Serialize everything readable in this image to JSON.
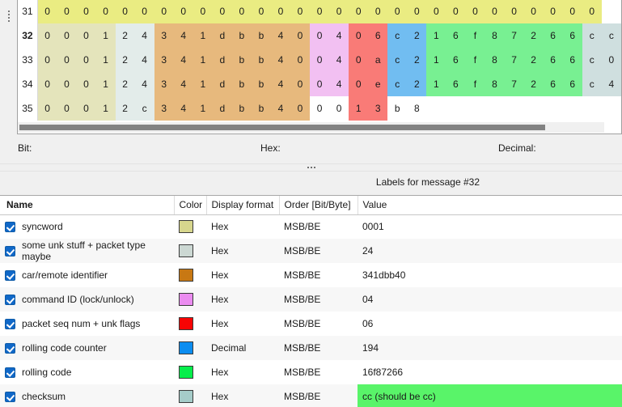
{
  "hex_view": {
    "row_header_label": "row-number",
    "selected_row": "32",
    "rows": [
      {
        "num": "31",
        "cells": [
          {
            "v": "0",
            "c": "#eaec82"
          },
          {
            "v": "0",
            "c": "#eaec82"
          },
          {
            "v": "0",
            "c": "#eaec82"
          },
          {
            "v": "0",
            "c": "#eaec82"
          },
          {
            "v": "0",
            "c": "#eaec82"
          },
          {
            "v": "0",
            "c": "#eaec82"
          },
          {
            "v": "0",
            "c": "#eaec82"
          },
          {
            "v": "0",
            "c": "#eaec82"
          },
          {
            "v": "0",
            "c": "#eaec82"
          },
          {
            "v": "0",
            "c": "#eaec82"
          },
          {
            "v": "0",
            "c": "#eaec82"
          },
          {
            "v": "0",
            "c": "#eaec82"
          },
          {
            "v": "0",
            "c": "#eaec82"
          },
          {
            "v": "0",
            "c": "#eaec82"
          },
          {
            "v": "0",
            "c": "#eaec82"
          },
          {
            "v": "0",
            "c": "#eaec82"
          },
          {
            "v": "0",
            "c": "#eaec82"
          },
          {
            "v": "0",
            "c": "#eaec82"
          },
          {
            "v": "0",
            "c": "#eaec82"
          },
          {
            "v": "0",
            "c": "#eaec82"
          },
          {
            "v": "0",
            "c": "#eaec82"
          },
          {
            "v": "0",
            "c": "#eaec82"
          },
          {
            "v": "0",
            "c": "#eaec82"
          },
          {
            "v": "0",
            "c": "#eaec82"
          },
          {
            "v": "0",
            "c": "#eaec82"
          },
          {
            "v": "0",
            "c": "#eaec82"
          },
          {
            "v": "0",
            "c": "#eaec82"
          },
          {
            "v": "0",
            "c": "#eaec82"
          },
          {
            "v": "0",
            "c": "#eaec82"
          }
        ]
      },
      {
        "num": "32",
        "selected": true,
        "cells": [
          {
            "v": "0",
            "c": "#e4e4bb"
          },
          {
            "v": "0",
            "c": "#e4e4bb"
          },
          {
            "v": "0",
            "c": "#e4e4bb"
          },
          {
            "v": "1",
            "c": "#e4e4bb"
          },
          {
            "v": "2",
            "c": "#e3ecea"
          },
          {
            "v": "4",
            "c": "#e3ecea"
          },
          {
            "v": "3",
            "c": "#e7b97d"
          },
          {
            "v": "4",
            "c": "#e7b97d"
          },
          {
            "v": "1",
            "c": "#e7b97d"
          },
          {
            "v": "d",
            "c": "#e7b97d"
          },
          {
            "v": "b",
            "c": "#e7b97d"
          },
          {
            "v": "b",
            "c": "#e7b97d"
          },
          {
            "v": "4",
            "c": "#e7b97d"
          },
          {
            "v": "0",
            "c": "#e7b97d"
          },
          {
            "v": "0",
            "c": "#f2c0f2"
          },
          {
            "v": "4",
            "c": "#f2c0f2"
          },
          {
            "v": "0",
            "c": "#f97b77"
          },
          {
            "v": "6",
            "c": "#f97b77"
          },
          {
            "v": "c",
            "c": "#71bdf1"
          },
          {
            "v": "2",
            "c": "#71bdf1"
          },
          {
            "v": "1",
            "c": "#78f092"
          },
          {
            "v": "6",
            "c": "#78f092"
          },
          {
            "v": "f",
            "c": "#78f092"
          },
          {
            "v": "8",
            "c": "#78f092"
          },
          {
            "v": "7",
            "c": "#78f092"
          },
          {
            "v": "2",
            "c": "#78f092"
          },
          {
            "v": "6",
            "c": "#78f092"
          },
          {
            "v": "6",
            "c": "#78f092"
          },
          {
            "v": "c",
            "c": "#cfdfdf"
          },
          {
            "v": "c",
            "c": "#cfdfdf"
          }
        ]
      },
      {
        "num": "33",
        "cells": [
          {
            "v": "0",
            "c": "#e4e4bb"
          },
          {
            "v": "0",
            "c": "#e4e4bb"
          },
          {
            "v": "0",
            "c": "#e4e4bb"
          },
          {
            "v": "1",
            "c": "#e4e4bb"
          },
          {
            "v": "2",
            "c": "#e3ecea"
          },
          {
            "v": "4",
            "c": "#e3ecea"
          },
          {
            "v": "3",
            "c": "#e7b97d"
          },
          {
            "v": "4",
            "c": "#e7b97d"
          },
          {
            "v": "1",
            "c": "#e7b97d"
          },
          {
            "v": "d",
            "c": "#e7b97d"
          },
          {
            "v": "b",
            "c": "#e7b97d"
          },
          {
            "v": "b",
            "c": "#e7b97d"
          },
          {
            "v": "4",
            "c": "#e7b97d"
          },
          {
            "v": "0",
            "c": "#e7b97d"
          },
          {
            "v": "0",
            "c": "#f2c0f2"
          },
          {
            "v": "4",
            "c": "#f2c0f2"
          },
          {
            "v": "0",
            "c": "#f97b77"
          },
          {
            "v": "a",
            "c": "#f97b77"
          },
          {
            "v": "c",
            "c": "#71bdf1"
          },
          {
            "v": "2",
            "c": "#71bdf1"
          },
          {
            "v": "1",
            "c": "#78f092"
          },
          {
            "v": "6",
            "c": "#78f092"
          },
          {
            "v": "f",
            "c": "#78f092"
          },
          {
            "v": "8",
            "c": "#78f092"
          },
          {
            "v": "7",
            "c": "#78f092"
          },
          {
            "v": "2",
            "c": "#78f092"
          },
          {
            "v": "6",
            "c": "#78f092"
          },
          {
            "v": "6",
            "c": "#78f092"
          },
          {
            "v": "c",
            "c": "#cfdfdf"
          },
          {
            "v": "0",
            "c": "#cfdfdf"
          }
        ]
      },
      {
        "num": "34",
        "cells": [
          {
            "v": "0",
            "c": "#e4e4bb"
          },
          {
            "v": "0",
            "c": "#e4e4bb"
          },
          {
            "v": "0",
            "c": "#e4e4bb"
          },
          {
            "v": "1",
            "c": "#e4e4bb"
          },
          {
            "v": "2",
            "c": "#e3ecea"
          },
          {
            "v": "4",
            "c": "#e3ecea"
          },
          {
            "v": "3",
            "c": "#e7b97d"
          },
          {
            "v": "4",
            "c": "#e7b97d"
          },
          {
            "v": "1",
            "c": "#e7b97d"
          },
          {
            "v": "d",
            "c": "#e7b97d"
          },
          {
            "v": "b",
            "c": "#e7b97d"
          },
          {
            "v": "b",
            "c": "#e7b97d"
          },
          {
            "v": "4",
            "c": "#e7b97d"
          },
          {
            "v": "0",
            "c": "#e7b97d"
          },
          {
            "v": "0",
            "c": "#f2c0f2"
          },
          {
            "v": "4",
            "c": "#f2c0f2"
          },
          {
            "v": "0",
            "c": "#f97b77"
          },
          {
            "v": "e",
            "c": "#f97b77"
          },
          {
            "v": "c",
            "c": "#71bdf1"
          },
          {
            "v": "2",
            "c": "#71bdf1"
          },
          {
            "v": "1",
            "c": "#78f092"
          },
          {
            "v": "6",
            "c": "#78f092"
          },
          {
            "v": "f",
            "c": "#78f092"
          },
          {
            "v": "8",
            "c": "#78f092"
          },
          {
            "v": "7",
            "c": "#78f092"
          },
          {
            "v": "2",
            "c": "#78f092"
          },
          {
            "v": "6",
            "c": "#78f092"
          },
          {
            "v": "6",
            "c": "#78f092"
          },
          {
            "v": "c",
            "c": "#cfdfdf"
          },
          {
            "v": "4",
            "c": "#cfdfdf"
          }
        ]
      },
      {
        "num": "35",
        "cells": [
          {
            "v": "0",
            "c": "#e4e4bb"
          },
          {
            "v": "0",
            "c": "#e4e4bb"
          },
          {
            "v": "0",
            "c": "#e4e4bb"
          },
          {
            "v": "1",
            "c": "#e4e4bb"
          },
          {
            "v": "2",
            "c": "#e3ecea"
          },
          {
            "v": "c",
            "c": "#e3ecea"
          },
          {
            "v": "3",
            "c": "#e7b97d"
          },
          {
            "v": "4",
            "c": "#e7b97d"
          },
          {
            "v": "1",
            "c": "#e7b97d"
          },
          {
            "v": "d",
            "c": "#e7b97d"
          },
          {
            "v": "b",
            "c": "#e7b97d"
          },
          {
            "v": "b",
            "c": "#e7b97d"
          },
          {
            "v": "4",
            "c": "#e7b97d"
          },
          {
            "v": "0",
            "c": "#e7b97d"
          },
          {
            "v": "0",
            "c": "#ffffff"
          },
          {
            "v": "0",
            "c": "#ffffff"
          },
          {
            "v": "1",
            "c": "#f97b77"
          },
          {
            "v": "3",
            "c": "#f97b77"
          },
          {
            "v": "b",
            "c": "#ffffff"
          },
          {
            "v": "8",
            "c": "#ffffff"
          },
          {
            "v": "",
            "c": "#ffffff"
          },
          {
            "v": "",
            "c": "#ffffff"
          },
          {
            "v": "",
            "c": "#ffffff"
          },
          {
            "v": "",
            "c": "#ffffff"
          },
          {
            "v": "",
            "c": "#ffffff"
          },
          {
            "v": "",
            "c": "#ffffff"
          },
          {
            "v": "",
            "c": "#ffffff"
          },
          {
            "v": "",
            "c": "#ffffff"
          },
          {
            "v": "",
            "c": "#ffffff"
          },
          {
            "v": "",
            "c": "#ffffff"
          }
        ]
      }
    ]
  },
  "info": {
    "bit_label": "Bit:",
    "hex_label": "Hex:",
    "decimal_label": "Decimal:",
    "bit_value": "",
    "hex_value": "",
    "decimal_value": ""
  },
  "caption": {
    "text": "Labels for message #32"
  },
  "label_table": {
    "headers": {
      "name": "Name",
      "color": "Color",
      "display_format": "Display format",
      "order": "Order [Bit/Byte]",
      "value": "Value"
    },
    "rows": [
      {
        "checked": true,
        "name": "syncword",
        "color": "#d7d68d",
        "display_format": "Hex",
        "order": "MSB/BE",
        "value": "0001",
        "value_highlight": false
      },
      {
        "checked": true,
        "name": "some unk stuff + packet type maybe",
        "color": "#ccd8d3",
        "display_format": "Hex",
        "order": "MSB/BE",
        "value": "24",
        "value_highlight": false
      },
      {
        "checked": true,
        "name": "car/remote identifier",
        "color": "#c87813",
        "display_format": "Hex",
        "order": "MSB/BE",
        "value": "341dbb40",
        "value_highlight": false
      },
      {
        "checked": true,
        "name": "command ID (lock/unlock)",
        "color": "#eb8cf0",
        "display_format": "Hex",
        "order": "MSB/BE",
        "value": "04",
        "value_highlight": false
      },
      {
        "checked": true,
        "name": "packet seq num + unk flags",
        "color": "#f70404",
        "display_format": "Hex",
        "order": "MSB/BE",
        "value": "06",
        "value_highlight": false
      },
      {
        "checked": true,
        "name": "rolling code counter",
        "color": "#0c8df0",
        "display_format": "Decimal",
        "order": "MSB/BE",
        "value": "194",
        "value_highlight": false
      },
      {
        "checked": true,
        "name": "rolling code",
        "color": "#06ee4b",
        "display_format": "Hex",
        "order": "MSB/BE",
        "value": "16f87266",
        "value_highlight": false
      },
      {
        "checked": true,
        "name": "checksum",
        "color": "#a5ccc9",
        "display_format": "Hex",
        "order": "MSB/BE",
        "value": "cc (should be cc)",
        "value_highlight": true
      }
    ]
  }
}
